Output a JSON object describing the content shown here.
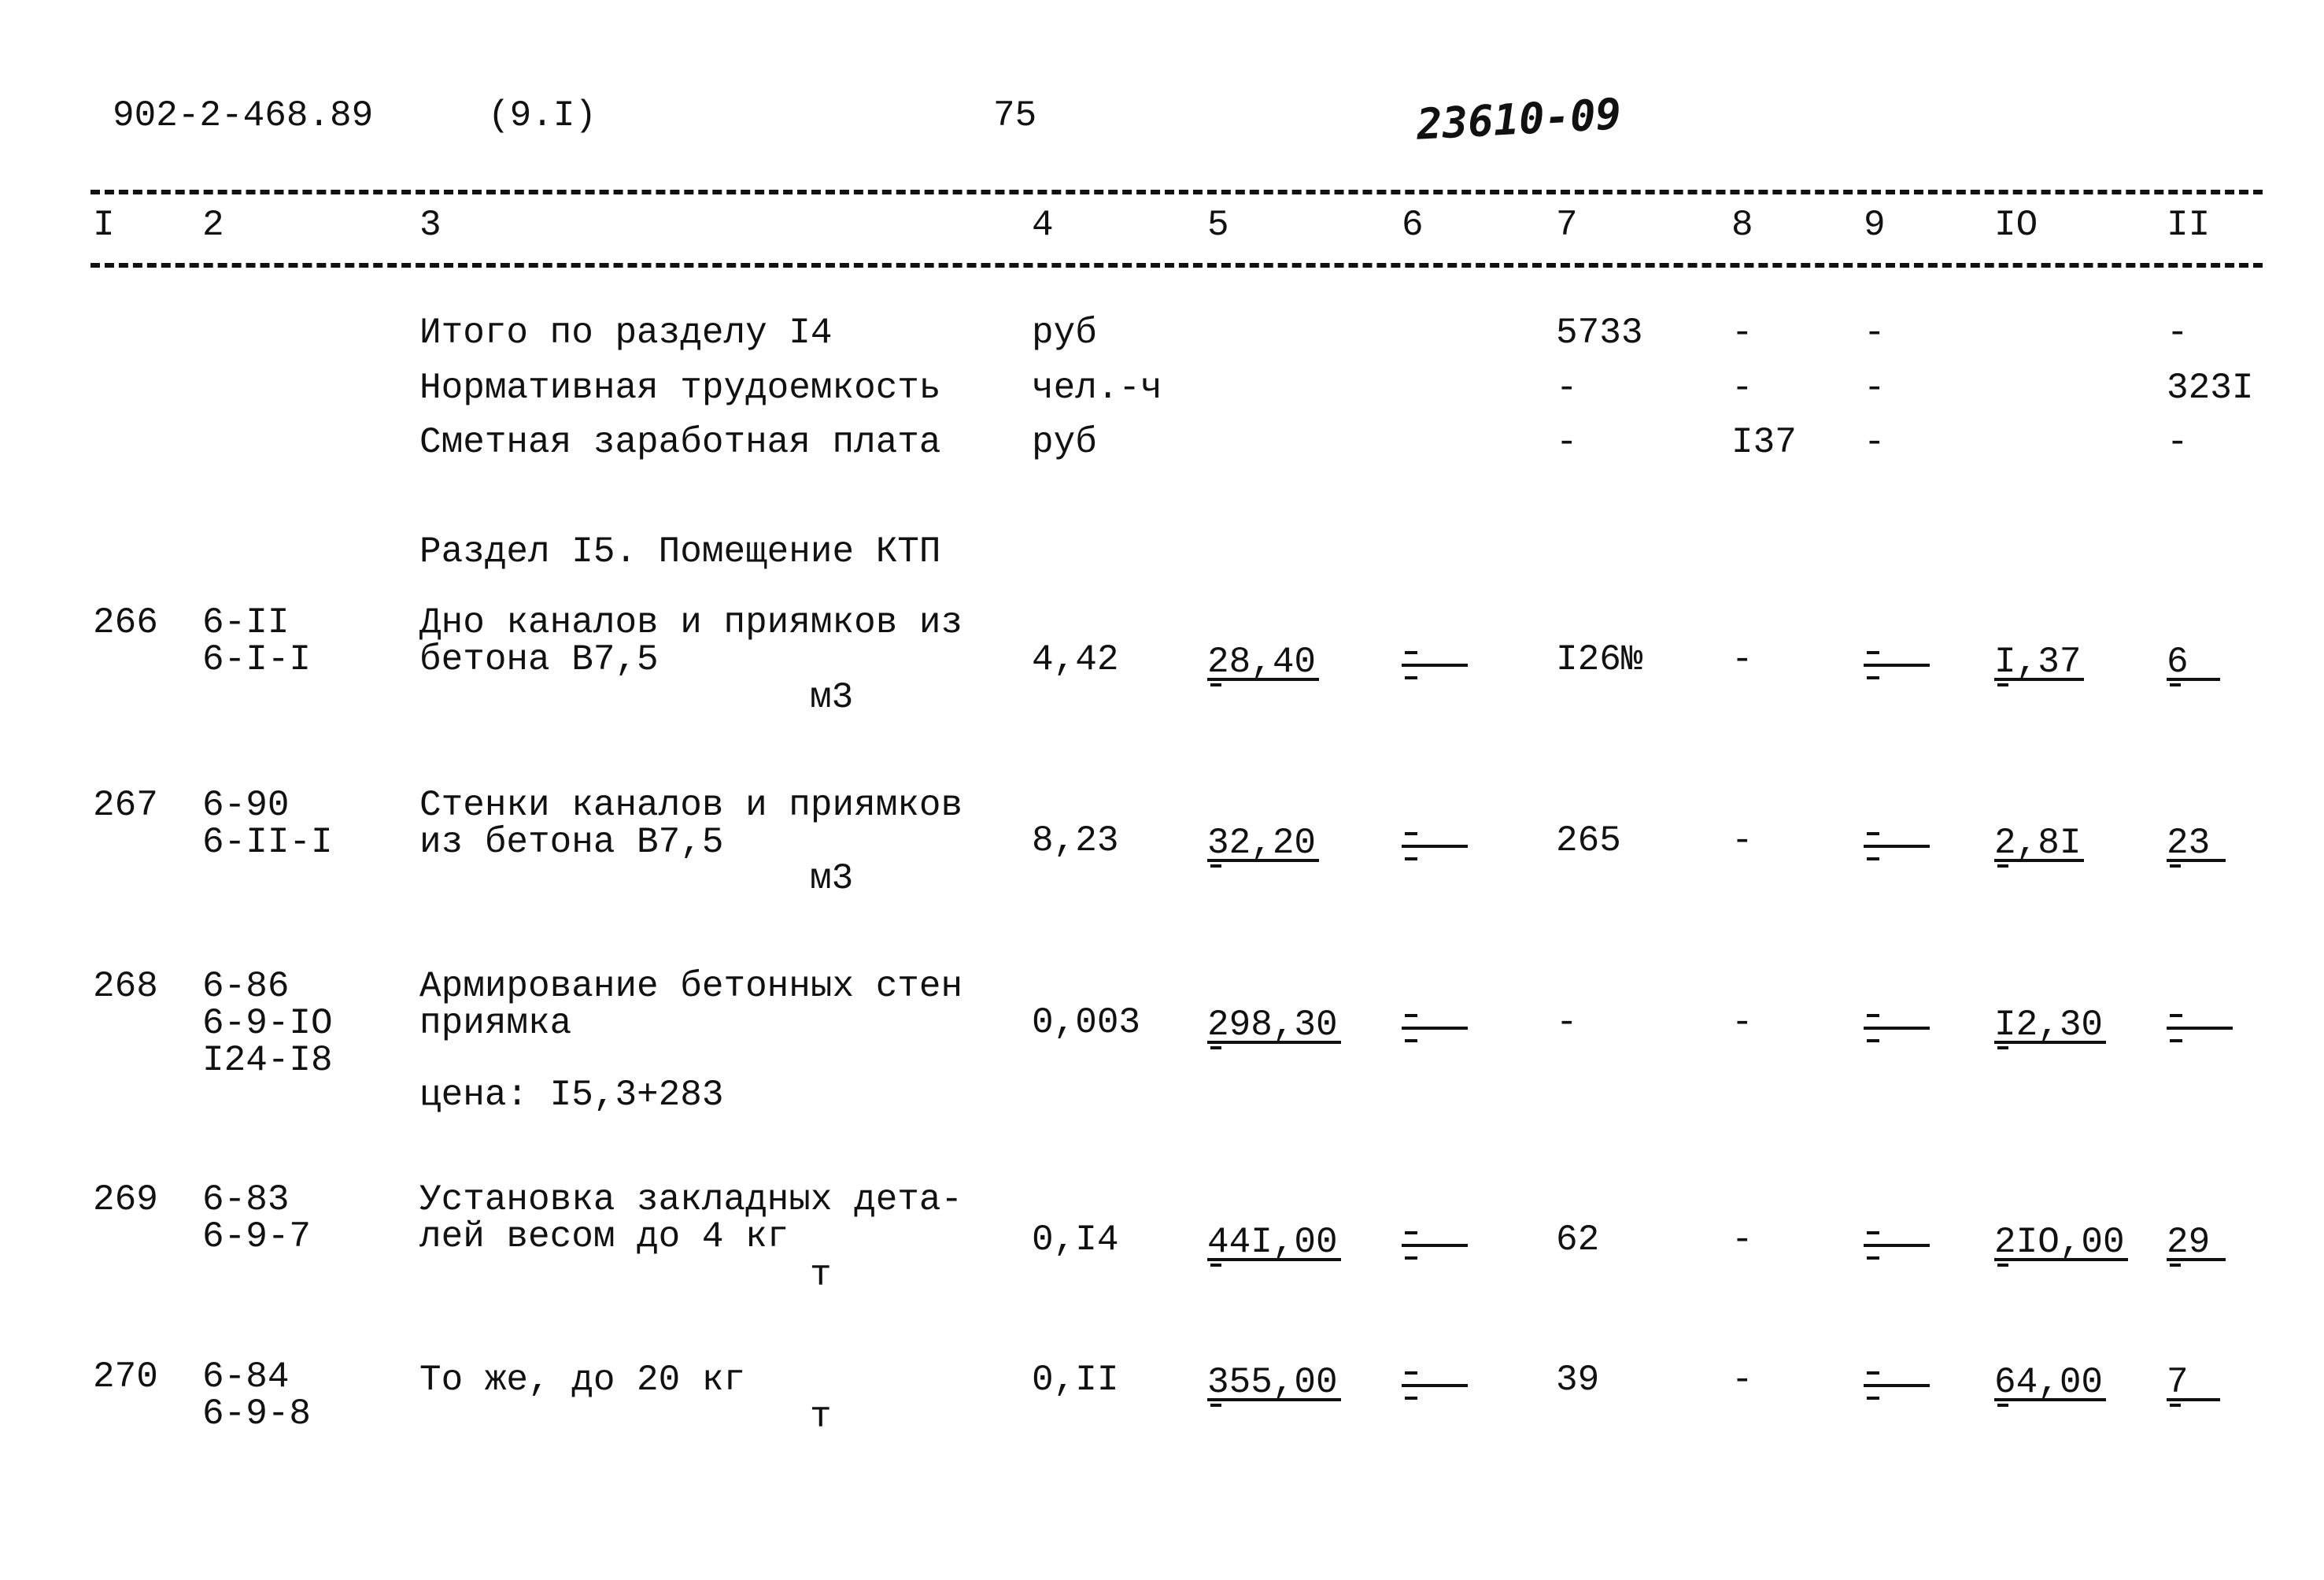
{
  "header": {
    "doc_code": "902-2-468.89",
    "section": "(9.I)",
    "page": "75",
    "stamp": "23610-09"
  },
  "columns": [
    "I",
    "2",
    "3",
    "4",
    "5",
    "6",
    "7",
    "8",
    "9",
    "IO",
    "II"
  ],
  "totals": [
    {
      "label": "Итого по разделу I4",
      "unit": "руб",
      "c7": "5733",
      "c8": "-",
      "c9": "-",
      "c11": "-"
    },
    {
      "label": "Нормативная трудоемкость",
      "unit": "чел.-ч",
      "c7": "-",
      "c8": "-",
      "c9": "-",
      "c11": "323I"
    },
    {
      "label": "Сметная заработная плата",
      "unit": "руб",
      "c7": "-",
      "c8": "I37",
      "c9": "-",
      "c11": "-"
    }
  ],
  "section_title": "Раздел I5. Помещение КТП",
  "rows": [
    {
      "num": "266",
      "codes": [
        "6-II",
        "6-I-I"
      ],
      "desc": [
        "Дно каналов и приямков из",
        "бетона В7,5"
      ],
      "unit": "м3",
      "c4": "4,42",
      "c5": "28,40",
      "c7": "I26№",
      "c8": "-",
      "c10": "I,37",
      "c11": "6"
    },
    {
      "num": "267",
      "codes": [
        "6-90",
        "6-II-I"
      ],
      "desc": [
        "Стенки каналов и приямков",
        "из бетона В7,5"
      ],
      "unit": "м3",
      "c4": "8,23",
      "c5": "32,20",
      "c7": "265",
      "c8": "-",
      "c10": "2,8I",
      "c11": "23"
    },
    {
      "num": "268",
      "codes": [
        "6-86",
        "6-9-IO",
        "I24-I8"
      ],
      "desc": [
        "Армирование бетонных стен",
        "приямка"
      ],
      "note": "цена: I5,3+283",
      "c4": "0,003",
      "c5": "298,30",
      "c7": "-",
      "c8": "-",
      "c10": "I2,30"
    },
    {
      "num": "269",
      "codes": [
        "6-83",
        "6-9-7"
      ],
      "desc": [
        "Установка закладных дета-",
        "лей весом до 4 кг"
      ],
      "unit": "т",
      "c4": "0,I4",
      "c5": "44I,00",
      "c7": "62",
      "c8": "-",
      "c10": "2IO,00",
      "c11": "29"
    },
    {
      "num": "270",
      "codes": [
        "6-84",
        "6-9-8"
      ],
      "desc": [
        "То же, до 20 кг"
      ],
      "unit": "т",
      "c4": "0,II",
      "c5": "355,00",
      "c7": "39",
      "c8": "-",
      "c10": "64,00",
      "c11": "7"
    }
  ]
}
